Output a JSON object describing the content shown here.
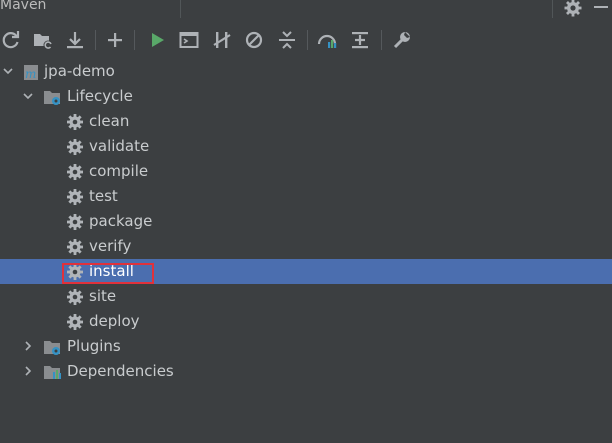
{
  "window": {
    "title": "Maven"
  },
  "toolbar": {
    "buttons": [
      {
        "name": "reload-icon"
      },
      {
        "name": "generate-sources-icon"
      },
      {
        "name": "download-icon"
      },
      {
        "name": "add-icon"
      },
      {
        "name": "run-icon"
      },
      {
        "name": "execute-goal-icon"
      },
      {
        "name": "toggle-offline-icon"
      },
      {
        "name": "skip-tests-icon"
      },
      {
        "name": "collapse-all-icon"
      },
      {
        "name": "diagram-icon"
      },
      {
        "name": "expand-icon"
      },
      {
        "name": "settings-wrench-icon"
      }
    ]
  },
  "tree": {
    "project": "jpa-demo",
    "lifecycle": {
      "label": "Lifecycle",
      "goals": [
        "clean",
        "validate",
        "compile",
        "test",
        "package",
        "verify",
        "install",
        "site",
        "deploy"
      ],
      "selected": "install"
    },
    "plugins": "Plugins",
    "dependencies": "Dependencies"
  },
  "colors": {
    "background": "#3c3f41",
    "selection": "#4b6eaf",
    "highlight_border": "#e0313b",
    "run_green": "#59a869",
    "maven_blue": "#3592c4"
  }
}
